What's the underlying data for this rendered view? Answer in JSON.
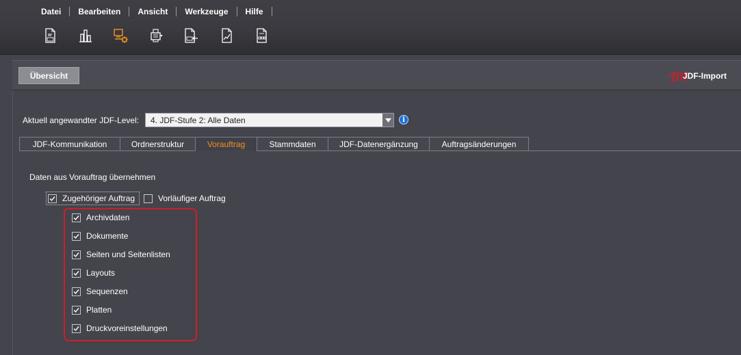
{
  "menu": [
    "Datei",
    "Bearbeiten",
    "Ansicht",
    "Werkzeuge",
    "Hilfe"
  ],
  "toolbar_icons": [
    "document-abc-icon",
    "building-blocks-icon",
    "workstation-gear-icon",
    "printer-list-icon",
    "document-abc-arrow-icon",
    "document-chart-icon",
    "document-grid-icon"
  ],
  "overview": {
    "button_label": "Übersicht",
    "logo_text": "JDF",
    "title": "JDF-Import"
  },
  "level": {
    "label": "Aktuell angewandter JDF-Level:",
    "selected": "4. JDF-Stufe 2: Alle Daten",
    "info_glyph": "i"
  },
  "tabs": [
    {
      "label": "JDF-Kommunikation",
      "active": false
    },
    {
      "label": "Ordnerstruktur",
      "active": false
    },
    {
      "label": "Vorauftrag",
      "active": true
    },
    {
      "label": "Stammdaten",
      "active": false
    },
    {
      "label": "JDF-Datenergänzung",
      "active": false
    },
    {
      "label": "Auftragsänderungen",
      "active": false
    }
  ],
  "panel": {
    "title": "Daten aus Vorauftrag übernehmen",
    "top_options": [
      {
        "label": "Zugehöriger Auftrag",
        "checked": true
      },
      {
        "label": "Vorläufiger Auftrag",
        "checked": false
      }
    ],
    "sub_options": [
      {
        "label": "Archivdaten",
        "checked": true
      },
      {
        "label": "Dokumente",
        "checked": true
      },
      {
        "label": "Seiten und Seitenlisten",
        "checked": true
      },
      {
        "label": "Layouts",
        "checked": true
      },
      {
        "label": "Sequenzen",
        "checked": true
      },
      {
        "label": "Platten",
        "checked": true
      },
      {
        "label": "Druckvoreinstellungen",
        "checked": true
      }
    ]
  },
  "colors": {
    "accent_orange": "#f0921c",
    "highlight_red": "#d21d2a",
    "background": "#44444c"
  }
}
